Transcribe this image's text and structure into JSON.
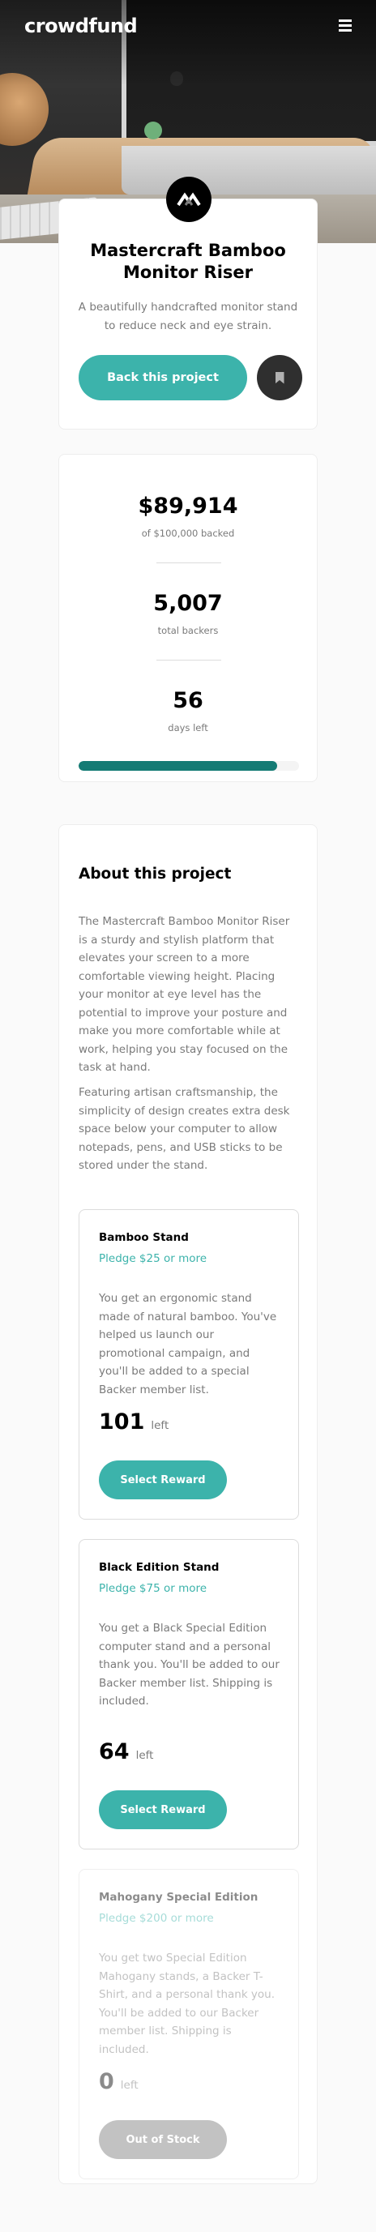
{
  "header": {
    "logo": "crowdfund"
  },
  "project": {
    "title": "Mastercraft Bamboo Monitor Riser",
    "description": "A beautifully handcrafted monitor stand to reduce neck and eye strain.",
    "back_button": "Back this project"
  },
  "stats": {
    "amount": "$89,914",
    "amount_label": "of $100,000 backed",
    "backers": "5,007",
    "backers_label": "total backers",
    "days": "56",
    "days_label": "days left",
    "progress_fraction": 0.89914
  },
  "about": {
    "heading": "About this project",
    "paragraph1": "The Mastercraft Bamboo Monitor Riser is a sturdy and stylish platform that elevates your screen to a more comfortable viewing height. Placing your monitor at eye level has the potential to improve your posture and make you more comfortable while at work, helping you stay focused on the task at hand.",
    "paragraph2": "Featuring artisan craftsmanship, the simplicity of design creates extra desk space below your computer to allow notepads, pens, and USB sticks to be stored under the stand."
  },
  "rewards": [
    {
      "title": "Bamboo Stand",
      "pledge": "Pledge $25 or more",
      "description": "You get an ergonomic stand made of natural bamboo. You've helped us launch our promotional campaign, and you'll be added to a special Backer member list.",
      "left": "101",
      "left_label": "left",
      "button": "Select Reward"
    },
    {
      "title": "Black Edition Stand",
      "pledge": "Pledge $75 or more",
      "description": "You get a Black Special Edition computer stand and a personal thank you. You'll be added to our Backer member list. Shipping is included.",
      "left": "64",
      "left_label": "left",
      "button": "Select Reward"
    },
    {
      "title": "Mahogany Special Edition",
      "pledge": "Pledge $200 or more",
      "description": "You get two Special Edition Mahogany stands, a Backer T-Shirt, and a personal thank you. You'll be added to our Backer member list. Shipping is included.",
      "left": "0",
      "left_label": "left",
      "button": "Out of Stock"
    }
  ],
  "colors": {
    "accent": "#3cb3ab",
    "accent_dark": "#147b74",
    "text_muted": "#7a7a7a"
  },
  "icons": {
    "menu": "hamburger-icon",
    "bookmark": "bookmark-icon",
    "project_logo": "mastercraft-logo-icon"
  }
}
